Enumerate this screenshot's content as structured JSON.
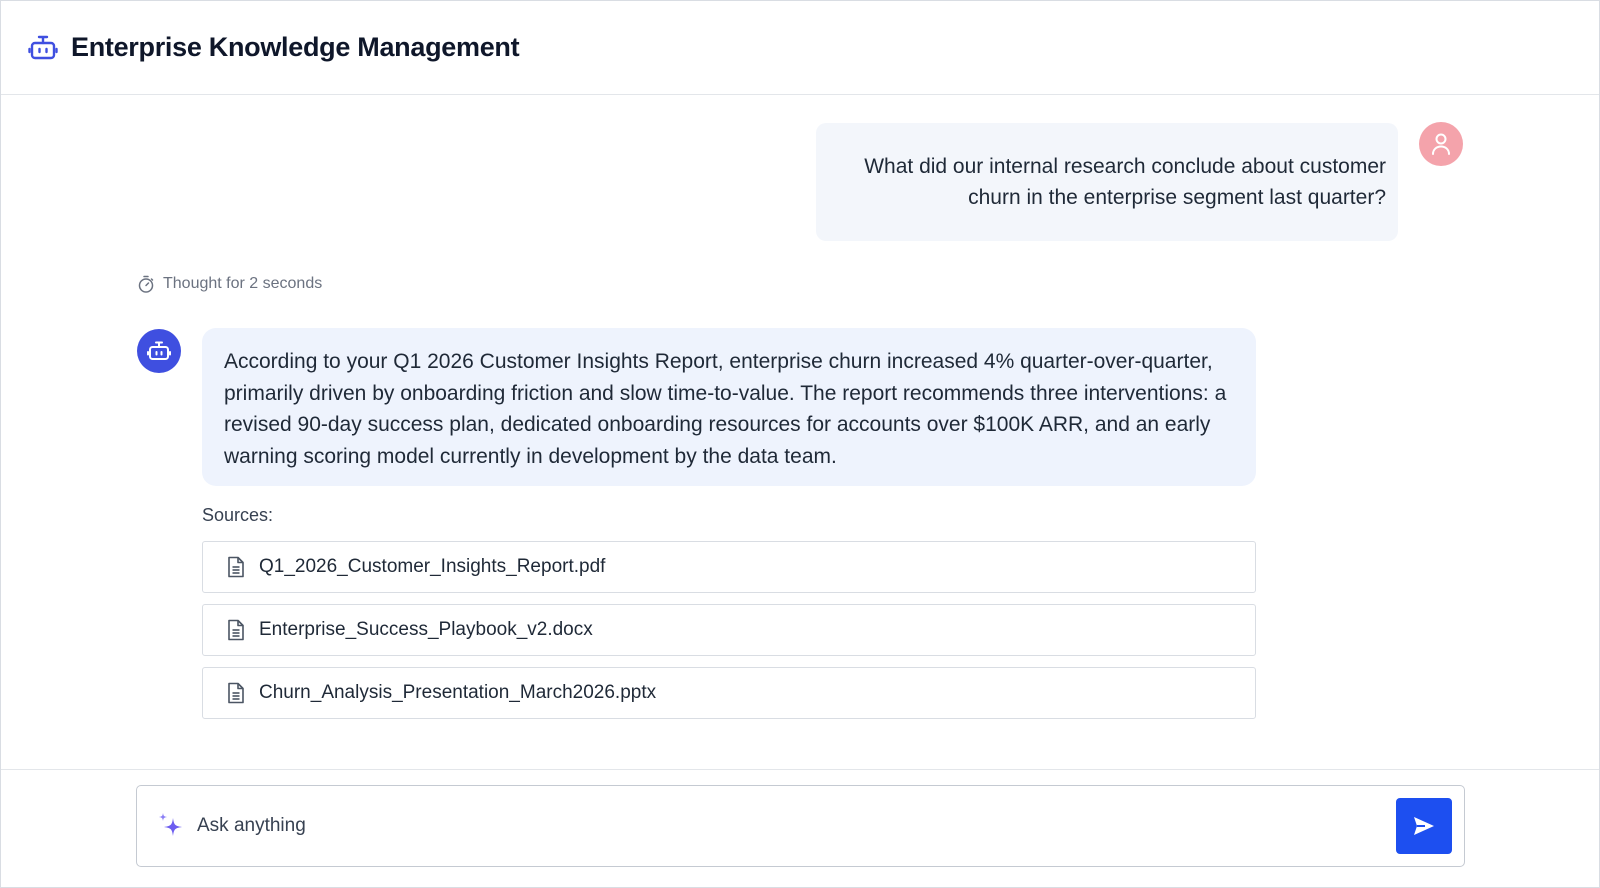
{
  "app": {
    "title": "Enterprise Knowledge Management",
    "logo_icon": "robot-icon",
    "accent_color": "#3f4fe0"
  },
  "conversation": {
    "user_message": "What did our internal research conclude about customer churn in the enterprise segment last quarter?",
    "user_avatar_icon": "user-icon",
    "user_avatar_color": "#f4a3ab",
    "thought_label": "Thought for 2 seconds",
    "thought_icon": "stopwatch-icon",
    "bot_avatar_icon": "robot-icon",
    "bot_message": "According to your Q1 2026 Customer Insights Report, enterprise churn increased 4% quarter-over-quarter, primarily driven by onboarding friction and slow time-to-value. The report recommends three interventions: a revised 90-day success plan, dedicated onboarding resources for accounts over $100K ARR, and an early warning scoring model currently in development by the data team.",
    "sources_label": "Sources:",
    "sources": [
      {
        "name": "Q1_2026_Customer_Insights_Report.pdf",
        "icon": "document-icon"
      },
      {
        "name": "Enterprise_Success_Playbook_v2.docx",
        "icon": "document-icon"
      },
      {
        "name": "Churn_Analysis_Presentation_March2026.pptx",
        "icon": "document-icon"
      }
    ]
  },
  "composer": {
    "placeholder": "Ask anything",
    "value": "",
    "sparkle_icon": "sparkle-icon",
    "send_icon": "send-icon",
    "send_color": "#1d4ff0"
  }
}
